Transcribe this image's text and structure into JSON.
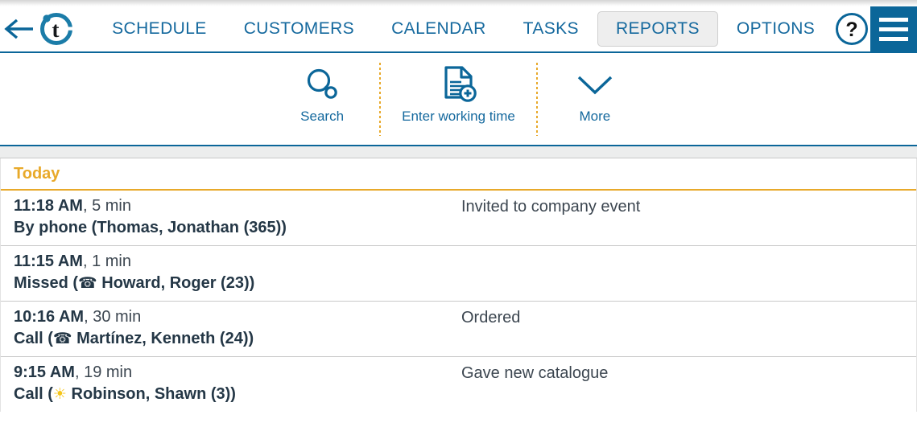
{
  "app": {
    "logo_letter": "t",
    "accent_blue": "#15699e",
    "accent_gold": "#e8a92a"
  },
  "navbar": {
    "back_icon": "arrow-left-icon",
    "items": [
      {
        "label": "SCHEDULE",
        "active": false
      },
      {
        "label": "CUSTOMERS",
        "active": false
      },
      {
        "label": "CALENDAR",
        "active": false
      },
      {
        "label": "TASKS",
        "active": false
      },
      {
        "label": "REPORTS",
        "active": true
      },
      {
        "label": "OPTIONS",
        "active": false
      }
    ],
    "help_label": "?",
    "menu_icon": "hamburger-menu-icon"
  },
  "toolbar": {
    "items": [
      {
        "label": "Search",
        "icon": "magnifier-icon"
      },
      {
        "label": "Enter working time",
        "icon": "document-plus-icon"
      },
      {
        "label": "More",
        "icon": "chevron-down-icon"
      }
    ]
  },
  "list": {
    "group_title": "Today",
    "rows": [
      {
        "time": "11:18 AM",
        "duration": ", 5 min",
        "subject_prefix": "By phone (Thomas, Jonathan (365))",
        "icon": "",
        "subject_after": "",
        "note": "Invited to company event"
      },
      {
        "time": "11:15 AM",
        "duration": ", 1 min",
        "subject_prefix": "Missed (",
        "icon": "☎",
        "subject_after": " Howard, Roger (23))",
        "note": ""
      },
      {
        "time": "10:16 AM",
        "duration": ", 30 min",
        "subject_prefix": "Call (",
        "icon": "☎",
        "subject_after": " Martínez, Kenneth (24))",
        "note": "Ordered"
      },
      {
        "time": "9:15 AM",
        "duration": ", 19 min",
        "subject_prefix": "Call (",
        "icon": "☀",
        "subject_after": " Robinson, Shawn (3))",
        "note": "Gave new catalogue"
      }
    ]
  }
}
